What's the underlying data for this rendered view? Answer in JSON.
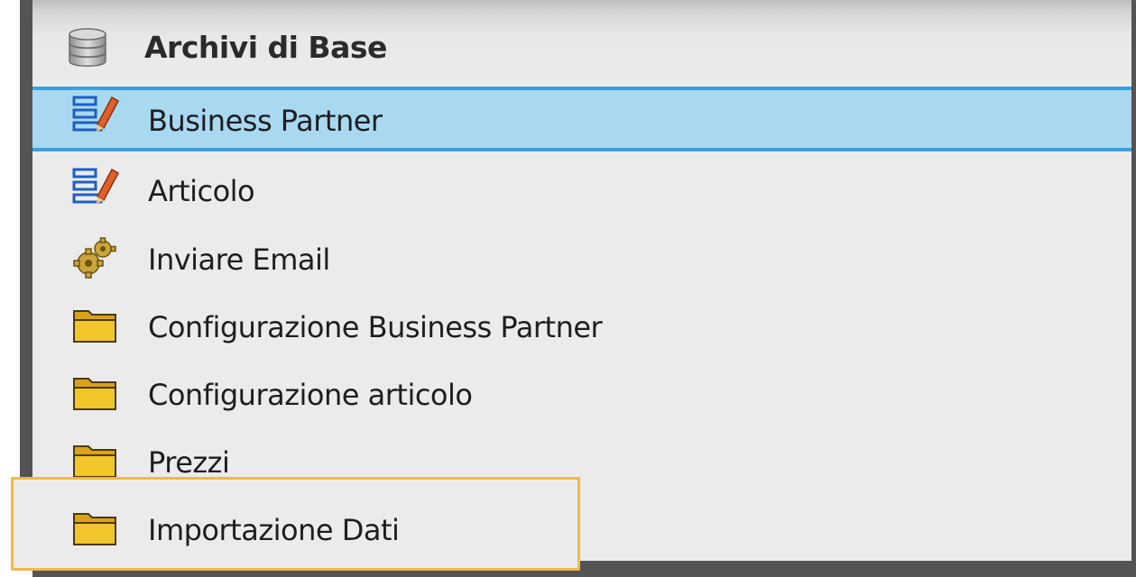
{
  "panel": {
    "title": "Archivi di Base",
    "title_icon": "database-icon"
  },
  "items": [
    {
      "label": "Business Partner",
      "icon": "window-edit-icon",
      "selected": true
    },
    {
      "label": "Articolo",
      "icon": "window-edit-icon",
      "selected": false
    },
    {
      "label": "Inviare Email",
      "icon": "gears-icon",
      "selected": false
    },
    {
      "label": "Configurazione Business Partner",
      "icon": "folder-icon",
      "selected": false
    },
    {
      "label": "Configurazione articolo",
      "icon": "folder-icon",
      "selected": false
    },
    {
      "label": "Prezzi",
      "icon": "folder-icon",
      "selected": false
    },
    {
      "label": "Importazione Dati",
      "icon": "folder-icon",
      "selected": false,
      "highlighted": true
    }
  ],
  "colors": {
    "selection_fill": "#a9d8f1",
    "selection_border": "#3aa1df",
    "highlight_border": "#f0b84a",
    "panel_bg": "#ebebeb",
    "frame": "#545454"
  }
}
